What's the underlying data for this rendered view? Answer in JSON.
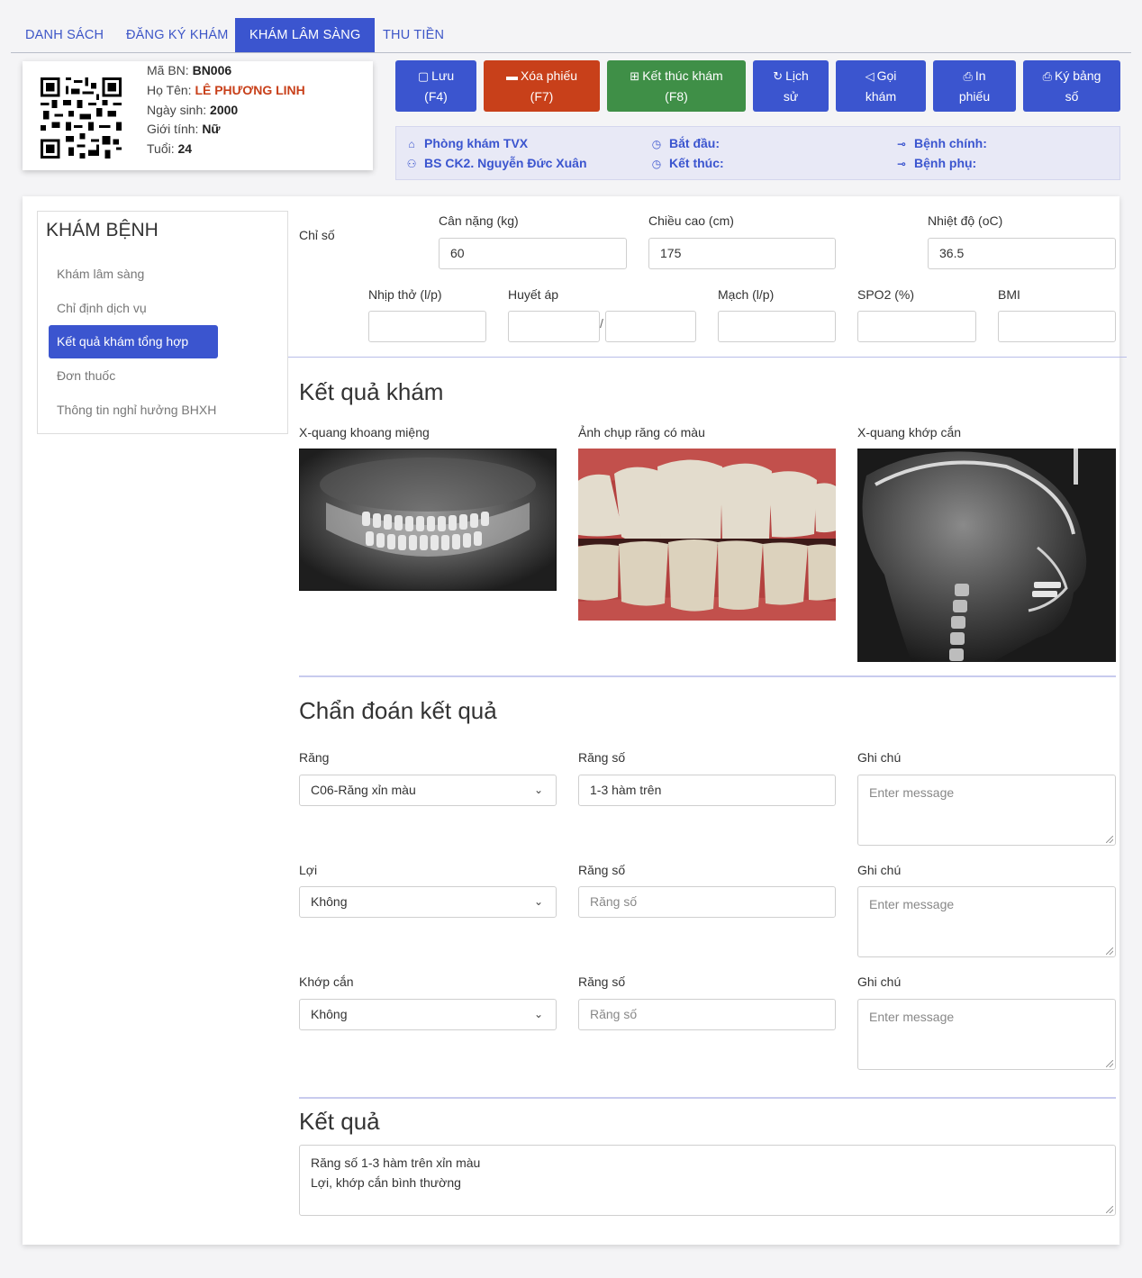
{
  "tabs": [
    {
      "label": "DANH SÁCH"
    },
    {
      "label": "ĐĂNG KÝ KHÁM"
    },
    {
      "label": "KHÁM LÂM SÀNG"
    },
    {
      "label": "THU TIỀN"
    }
  ],
  "patient": {
    "code_label": "Mã BN:",
    "code": "BN006",
    "name_label": "Họ Tên:",
    "name": "LÊ PHƯƠNG LINH",
    "dob_label": "Ngày sinh:",
    "dob": "2000",
    "gender_label": "Giới tính:",
    "gender": "Nữ",
    "age_label": "Tuổi:",
    "age": "24"
  },
  "toolbar": {
    "save": {
      "line1": "Lưu",
      "line2": "(F4)"
    },
    "delete": {
      "line1": "Xóa phiếu",
      "line2": "(F7)"
    },
    "finish": {
      "line1": "Kết thúc khám",
      "line2": "(F8)"
    },
    "history": {
      "line1": "Lịch",
      "line2": "sử"
    },
    "call": {
      "line1": "Gọi",
      "line2": "khám"
    },
    "print": {
      "line1": "In",
      "line2": "phiếu"
    },
    "sign": {
      "line1": "Ký bảng",
      "line2": "số"
    }
  },
  "info": {
    "clinic": "Phòng khám TVX",
    "doctor": "BS CK2. Nguyễn Đức Xuân",
    "start": "Bắt đầu:",
    "end": "Kết thúc:",
    "main_disease": "Bệnh chính:",
    "sub_disease": "Bệnh phụ:"
  },
  "sidebar": {
    "title": "KHÁM BỆNH",
    "items": [
      {
        "label": "Khám lâm sàng"
      },
      {
        "label": "Chỉ định dịch vụ"
      },
      {
        "label": "Kết quả khám tổng hợp"
      },
      {
        "label": "Đơn thuốc"
      },
      {
        "label": "Thông tin nghỉ hưởng BHXH"
      }
    ]
  },
  "vitals": {
    "section_label": "Chỉ số",
    "weight_label": "Cân nặng (kg)",
    "weight": "60",
    "height_label": "Chiều cao (cm)",
    "height": "175",
    "temp_label": "Nhiệt độ (oC)",
    "temp": "36.5",
    "resp_label": "Nhịp thở (l/p)",
    "resp": "",
    "bp_label": "Huyết áp",
    "bp_sep": "/",
    "pulse_label": "Mạch (l/p)",
    "pulse": "",
    "spo2_label": "SPO2 (%)",
    "spo2": "",
    "bmi_label": "BMI",
    "bmi": ""
  },
  "results": {
    "title": "Kết quả khám",
    "img1_label": "X-quang khoang miệng",
    "img2_label": "Ảnh chụp răng có màu",
    "img3_label": "X-quang khớp cắn"
  },
  "diagnosis": {
    "title": "Chẩn đoán kết quả",
    "rows": [
      {
        "cat_label": "Răng",
        "cat_value": "C06-Răng xỉn màu",
        "tooth_label": "Răng số",
        "tooth_value": "1-3 hàm trên",
        "note_label": "Ghi chú",
        "note_placeholder": "Enter message"
      },
      {
        "cat_label": "Lợi",
        "cat_value": "Không",
        "tooth_label": "Răng số",
        "tooth_placeholder": "Răng số",
        "note_label": "Ghi chú",
        "note_placeholder": "Enter message"
      },
      {
        "cat_label": "Khớp cắn",
        "cat_value": "Không",
        "tooth_label": "Răng số",
        "tooth_placeholder": "Răng số",
        "note_label": "Ghi chú",
        "note_placeholder": "Enter message"
      }
    ]
  },
  "conclusion": {
    "title": "Kết quả",
    "line1": "Răng số 1-3 hàm trên xỉn màu",
    "line2": "Lợi, khớp cắn bình thường"
  },
  "colors": {
    "primary": "#3b55cf",
    "danger": "#c8401a",
    "success": "#3f8f47"
  },
  "icons": [
    "save-icon",
    "trash-icon",
    "plus-square-icon",
    "history-icon",
    "megaphone-icon",
    "printer-icon",
    "home-icon",
    "users-icon",
    "clock-icon",
    "key-icon",
    "chevron-down-icon",
    "qr-code-icon"
  ]
}
